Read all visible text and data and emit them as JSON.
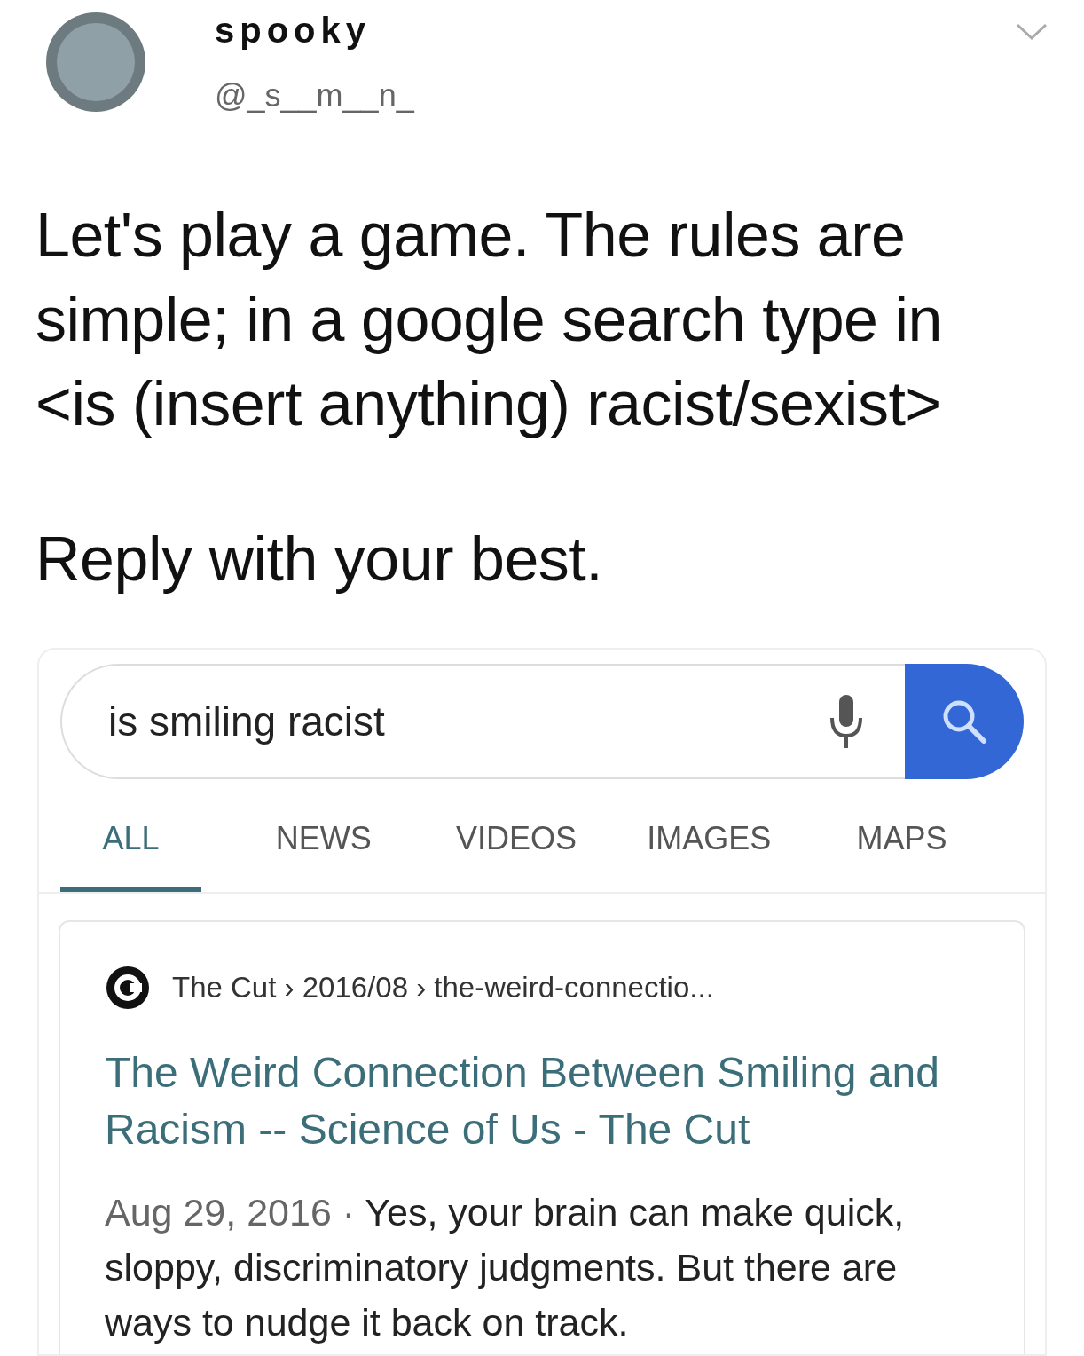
{
  "tweet": {
    "display_name": "spooky",
    "handle": "@_s__m__n_",
    "paragraphs": [
      "Let's play a game. The rules are simple; in a google search type in <is (insert anything) racist/sexist>",
      "Reply with your best."
    ]
  },
  "search": {
    "query": "is smiling racist"
  },
  "tabs": [
    {
      "label": "ALL",
      "selected": true
    },
    {
      "label": "NEWS",
      "selected": false
    },
    {
      "label": "VIDEOS",
      "selected": false
    },
    {
      "label": "IMAGES",
      "selected": false
    },
    {
      "label": "MAPS",
      "selected": false
    }
  ],
  "result": {
    "breadcrumb": "The Cut › 2016/08 › the-weird-connectio...",
    "title": "The Weird Connection Between Smiling and Racism -- Science of Us - The Cut",
    "date": "Aug 29, 2016 · ",
    "snippet": "Yes, your brain can make quick, sloppy, discriminatory judgments. But there are ways to nudge it back on track."
  }
}
